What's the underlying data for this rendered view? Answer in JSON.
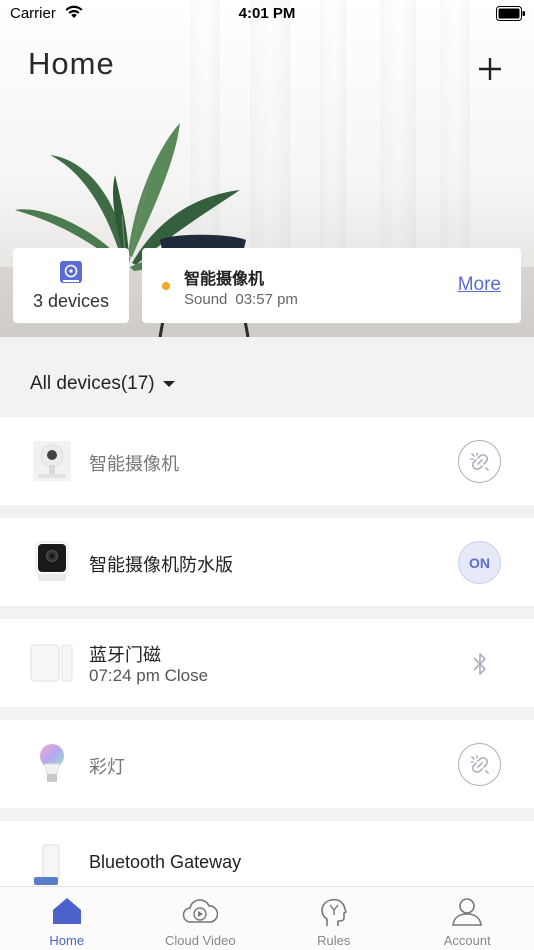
{
  "status_bar": {
    "carrier": "Carrier",
    "time": "4:01 PM"
  },
  "header": {
    "title": "Home"
  },
  "summary": {
    "devices_count": "3 devices"
  },
  "latest_event": {
    "device": "智能摄像机",
    "type": "Sound",
    "time": "03:57 pm",
    "more": "More"
  },
  "filter": {
    "label": "All devices(17)"
  },
  "devices": [
    {
      "name": "智能摄像机",
      "status": "",
      "action": "unlink-icon"
    },
    {
      "name": "智能摄像机防水版",
      "status": "",
      "action": "ON"
    },
    {
      "name": "蓝牙门磁",
      "status": "07:24 pm Close",
      "action": "bluetooth-icon"
    },
    {
      "name": "彩灯",
      "status": "",
      "action": "unlink-icon"
    },
    {
      "name": "Bluetooth Gateway",
      "status": "",
      "action": ""
    }
  ],
  "tabs": [
    {
      "label": "Home",
      "icon": "home-icon",
      "active": true
    },
    {
      "label": "Cloud Video",
      "icon": "cloud-video-icon",
      "active": false
    },
    {
      "label": "Rules",
      "icon": "rules-icon",
      "active": false
    },
    {
      "label": "Account",
      "icon": "account-icon",
      "active": false
    }
  ],
  "colors": {
    "accent": "#4a62c9",
    "event_dot": "#f5a623",
    "background": "#f2f2f5"
  }
}
